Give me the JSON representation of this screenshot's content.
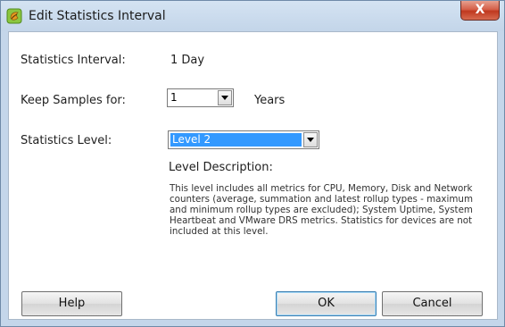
{
  "window": {
    "title": "Edit Statistics Interval",
    "close_symbol": "X"
  },
  "form": {
    "interval_label": "Statistics Interval:",
    "interval_value": "1 Day",
    "keep_label": "Keep Samples for:",
    "keep_value": "1",
    "keep_unit": "Years",
    "level_label": "Statistics Level:",
    "level_value": "Level 2",
    "description_label": "Level Description:",
    "description_text": "This level includes all metrics for CPU, Memory, Disk and Network counters (average, summation and latest rollup types - maximum and minimum rollup types are excluded); System Uptime, System Heartbeat and VMware DRS metrics. Statistics for devices are not included at this level."
  },
  "buttons": {
    "help": "Help",
    "ok": "OK",
    "cancel": "Cancel"
  },
  "icons": {
    "app": "vsphere-logo-icon",
    "dropdown": "chevron-down-icon",
    "close": "close-icon"
  },
  "colors": {
    "selection": "#3399ff",
    "close_button": "#c8462b",
    "frame": "#c4d6ea"
  }
}
